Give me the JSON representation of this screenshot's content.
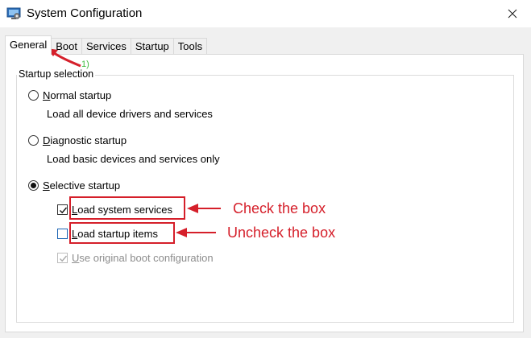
{
  "window": {
    "title": "System Configuration",
    "icons": {
      "app": "system-config-icon",
      "close": "close-icon"
    }
  },
  "tabs": [
    {
      "label": "General",
      "active": true
    },
    {
      "label": "Boot",
      "active": false
    },
    {
      "label": "Services",
      "active": false
    },
    {
      "label": "Startup",
      "active": false
    },
    {
      "label": "Tools",
      "active": false
    }
  ],
  "general": {
    "group_label": "Startup selection",
    "normal": {
      "label": "Normal startup",
      "underline": "N",
      "rest": "ormal startup",
      "desc": "Load all device drivers and services",
      "selected": false
    },
    "diagnostic": {
      "label": "Diagnostic startup",
      "underline": "D",
      "rest": "iagnostic startup",
      "desc": "Load basic devices and services only",
      "selected": false
    },
    "selective": {
      "label": "Selective startup",
      "underline": "S",
      "rest": "elective startup",
      "selected": true,
      "options": [
        {
          "label": "Load system services",
          "underline": "L",
          "rest": "oad system services",
          "checked": true,
          "enabled": true
        },
        {
          "label": "Load startup items",
          "underline": "L",
          "rest": "oad startup items",
          "checked": false,
          "enabled": true
        },
        {
          "label": "Use original boot configuration",
          "underline": "U",
          "rest": "se original boot configuration",
          "checked": true,
          "enabled": false
        }
      ]
    }
  },
  "annotations": {
    "step": "1)",
    "check": "Check the box",
    "uncheck": "Uncheck the box",
    "color": "#d51f2a",
    "step_color": "#3dbb3d"
  }
}
